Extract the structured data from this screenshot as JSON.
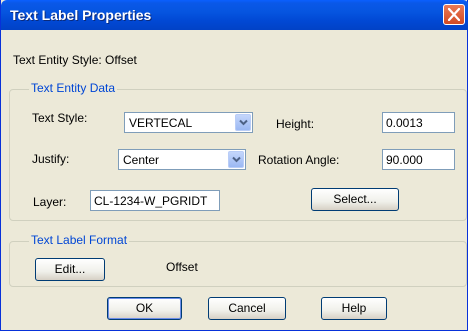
{
  "window": {
    "title": "Text Label Properties"
  },
  "header": {
    "entity_style_text": "Text Entity Style: Offset"
  },
  "text_entity_data": {
    "group_title": "Text Entity Data",
    "text_style_label": "Text Style:",
    "text_style_value": "VERTECAL",
    "height_label": "Height:",
    "height_value": "0.0013",
    "justify_label": "Justify:",
    "justify_value": "Center",
    "rotation_label": "Rotation Angle:",
    "rotation_value": "90.000",
    "layer_label": "Layer:",
    "layer_value": "CL-1234-W_PGRIDT",
    "select_button": "Select..."
  },
  "text_label_format": {
    "group_title": "Text Label Format",
    "edit_button": "Edit...",
    "format_value": "Offset"
  },
  "footer": {
    "ok_button": "OK",
    "cancel_button": "Cancel",
    "help_button": "Help"
  },
  "icons": {
    "close": "close-icon",
    "dropdown": "chevron-down-icon"
  },
  "colors": {
    "titlebar": "#0148d4",
    "group_title": "#0046d5",
    "close_button": "#d24a22"
  }
}
